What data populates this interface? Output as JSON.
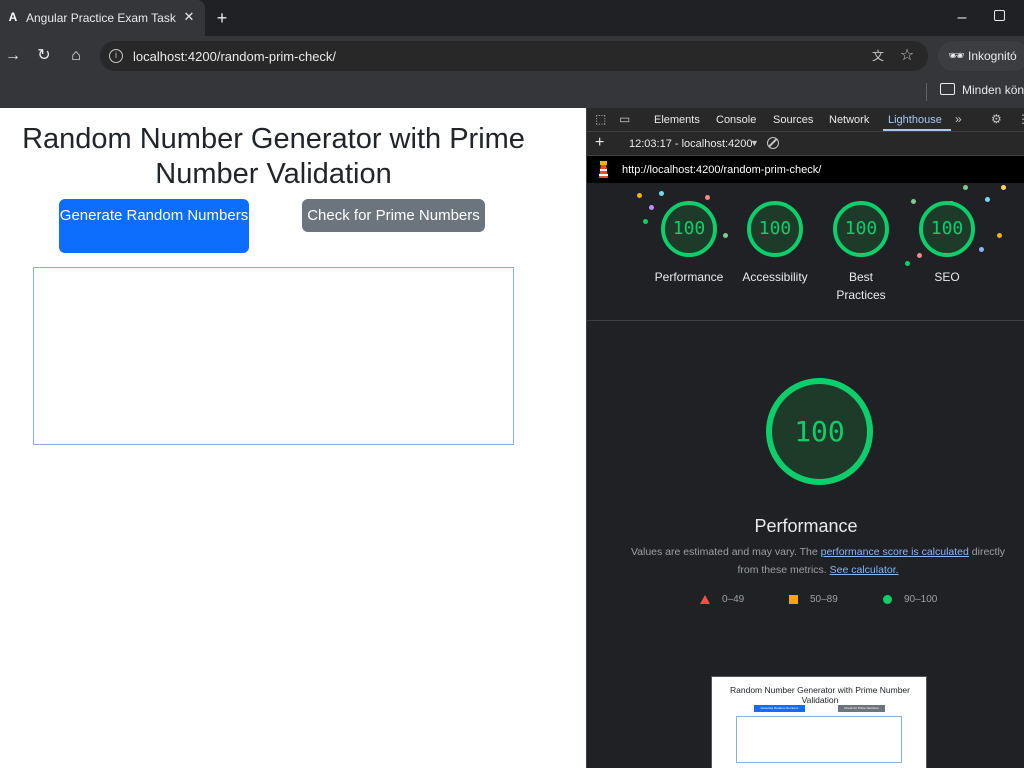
{
  "browser": {
    "tab_title": "Angular Practice Exam Task",
    "tab_favicon": "angular-icon",
    "tab_close": "✕",
    "new_tab": "+",
    "url": "localhost:4200/random-prim-check/",
    "incognito_label": "Inkognitó",
    "bookmarks_folder": "Minden köny"
  },
  "page": {
    "heading": "Random Number Generator with Prime Number Validation",
    "generate_button": "Generate Random Numbers",
    "check_button": "Check for Prime Numbers",
    "output_value": ""
  },
  "devtools": {
    "tabs": [
      "Elements",
      "Console",
      "Sources",
      "Network",
      "Lighthouse"
    ],
    "active_tab": "Lighthouse",
    "run_label": "12:03:17 - localhost:4200",
    "report_url": "http://localhost:4200/random-prim-check/",
    "categories": [
      {
        "label": "Performance",
        "score": "100"
      },
      {
        "label": "Accessibility",
        "score": "100"
      },
      {
        "label": "Best Practices",
        "score": "100"
      },
      {
        "label": "SEO",
        "score": "100"
      }
    ],
    "main_score": "100",
    "main_title": "Performance",
    "desc_before": "Values are estimated and may vary. The ",
    "desc_link1": "performance score is calculated",
    "desc_middle": " directly from these metrics. ",
    "desc_link2": "See calculator.",
    "legend": [
      {
        "range": "0–49",
        "color": "#ff4e42",
        "shape": "triangle"
      },
      {
        "range": "50–89",
        "color": "#ffa400",
        "shape": "square"
      },
      {
        "range": "90–100",
        "color": "#0cce6b",
        "shape": "circle"
      }
    ],
    "thumbnail": {
      "heading": "Random Number Generator with Prime Number Validation",
      "generate": "Generate Random Numbers",
      "check": "Check for Prime Numbers"
    }
  },
  "colors": {
    "pass": "#0cce6b",
    "primary_button": "#0d6efd",
    "secondary_button": "#6c757d",
    "devtools_accent": "#a8c7fa"
  }
}
